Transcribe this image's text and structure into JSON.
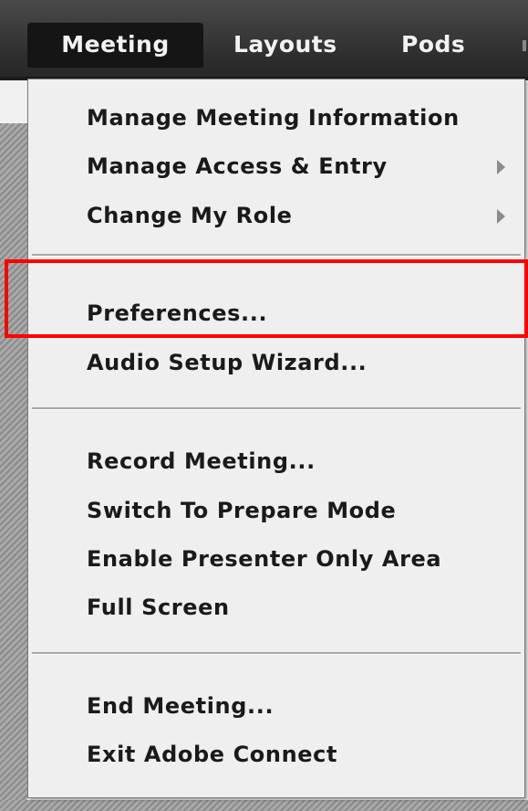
{
  "menubar": {
    "items": [
      {
        "label": "Meeting",
        "active": true
      },
      {
        "label": "Layouts"
      },
      {
        "label": "Pods"
      }
    ]
  },
  "dropdown": {
    "groups": [
      [
        {
          "label": "Manage Meeting Information",
          "submenu": false
        },
        {
          "label": "Manage Access & Entry",
          "submenu": true
        },
        {
          "label": "Change My Role",
          "submenu": true
        }
      ],
      [
        {
          "label": "Preferences...",
          "highlighted": true
        },
        {
          "label": "Audio Setup Wizard..."
        }
      ],
      [
        {
          "label": "Record Meeting..."
        },
        {
          "label": "Switch To Prepare Mode"
        },
        {
          "label": "Enable Presenter Only Area"
        },
        {
          "label": "Full Screen"
        }
      ],
      [
        {
          "label": "End Meeting..."
        },
        {
          "label": "Exit Adobe Connect"
        }
      ]
    ]
  },
  "colors": {
    "menubar_bg": "#2e2e2e",
    "active_tab_bg": "#151515",
    "menu_bg": "#efefef",
    "menu_text": "#1a1a1a",
    "highlight_border": "#ff0000"
  }
}
